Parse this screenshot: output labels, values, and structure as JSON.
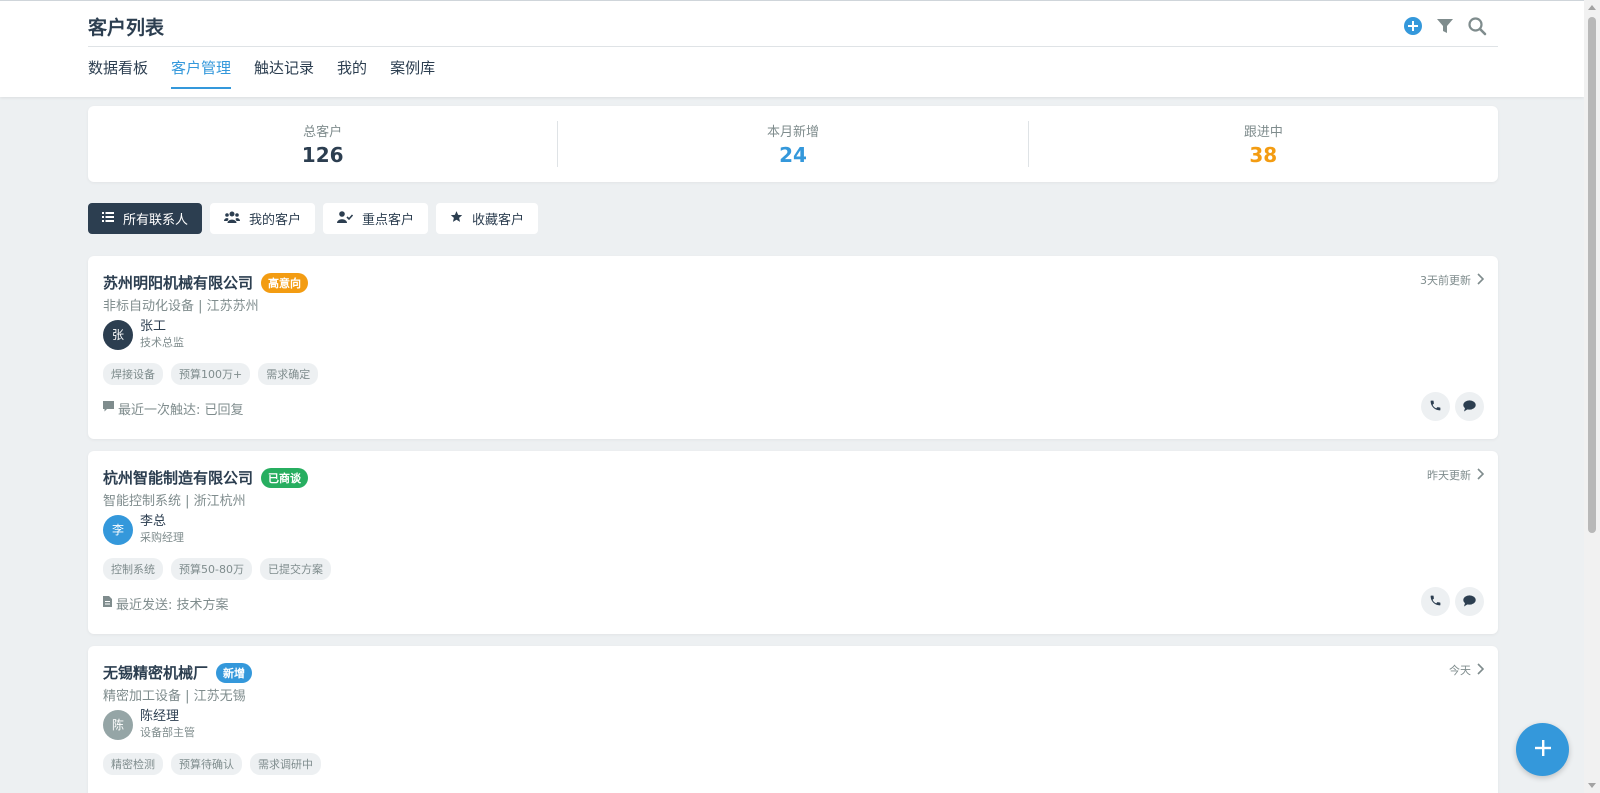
{
  "header": {
    "title": "客户列表",
    "icons": [
      "plus-circle-icon",
      "filter-icon",
      "search-icon"
    ]
  },
  "tabs": [
    {
      "label": "数据看板",
      "active": false
    },
    {
      "label": "客户管理",
      "active": true
    },
    {
      "label": "触达记录",
      "active": false
    },
    {
      "label": "我的",
      "active": false
    },
    {
      "label": "案例库",
      "active": false
    }
  ],
  "stats": [
    {
      "label": "总客户",
      "value": "126",
      "color": "#2c3e50"
    },
    {
      "label": "本月新增",
      "value": "24",
      "color": "#3498db"
    },
    {
      "label": "跟进中",
      "value": "38",
      "color": "#f39c12"
    }
  ],
  "filters": [
    {
      "label": "所有联系人",
      "icon": "list-icon",
      "active": true
    },
    {
      "label": "我的客户",
      "icon": "users-icon",
      "active": false
    },
    {
      "label": "重点客户",
      "icon": "user-check-icon",
      "active": false
    },
    {
      "label": "收藏客户",
      "icon": "star-icon",
      "active": false
    }
  ],
  "customers": [
    {
      "company": "苏州明阳机械有限公司",
      "badge": "高意向",
      "badge_color": "#f39c12",
      "industry": "非标自动化设备 | 江苏苏州",
      "contact_initial": "张",
      "contact_name": "张工",
      "contact_role": "技术总监",
      "avatar_color": "#2c3e50",
      "tags": [
        "焊接设备",
        "预算100万+",
        "需求确定"
      ],
      "updated": "3天前更新",
      "recent_icon": "comment-icon",
      "recent": "最近一次触达: 已回复"
    },
    {
      "company": "杭州智能制造有限公司",
      "badge": "已商谈",
      "badge_color": "#27ae60",
      "industry": "智能控制系统 | 浙江杭州",
      "contact_initial": "李",
      "contact_name": "李总",
      "contact_role": "采购经理",
      "avatar_color": "#3498db",
      "tags": [
        "控制系统",
        "预算50-80万",
        "已提交方案"
      ],
      "updated": "昨天更新",
      "recent_icon": "file-icon",
      "recent": "最近发送: 技术方案"
    },
    {
      "company": "无锡精密机械厂",
      "badge": "新增",
      "badge_color": "#3498db",
      "industry": "精密加工设备 | 江苏无锡",
      "contact_initial": "陈",
      "contact_name": "陈经理",
      "contact_role": "设备部主管",
      "avatar_color": "#95a5a6",
      "tags": [
        "精密检测",
        "预算待确认",
        "需求调研中"
      ],
      "updated": "今天",
      "recent_icon": "",
      "recent": ""
    }
  ],
  "fab": {
    "icon": "plus-icon"
  }
}
